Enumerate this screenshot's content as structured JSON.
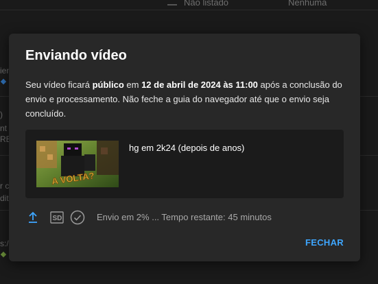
{
  "background": {
    "header_visibility": "Não listado",
    "header_restrictions": "Nenhuma",
    "left_fragments": [
      "ien",
      ")",
      "nt",
      "RE",
      "r c",
      "dit",
      "s:/"
    ]
  },
  "dialog": {
    "title": "Enviando vídeo",
    "message": {
      "part1": "Seu vídeo ficará ",
      "visibility": "público",
      "part2": " em ",
      "datetime": "12 de abril de 2024 às 11:00",
      "part3": " após a conclusão do envio e processamento. Não feche a guia do navegador até que o envio seja concluído."
    },
    "video": {
      "title": "hg em 2k24 (depois de anos)",
      "thumbnail_text": "A VOLTA?"
    },
    "status": {
      "icons": [
        "upload-icon",
        "sd-icon",
        "check-circle-icon"
      ],
      "text": "Envio em 2% ... Tempo restante: 45 minutos",
      "progress_percent": 2
    },
    "close_label": "FECHAR"
  },
  "colors": {
    "accent": "#3ea6ff",
    "dialog_bg": "#282828",
    "card_bg": "#1b1b1b"
  }
}
